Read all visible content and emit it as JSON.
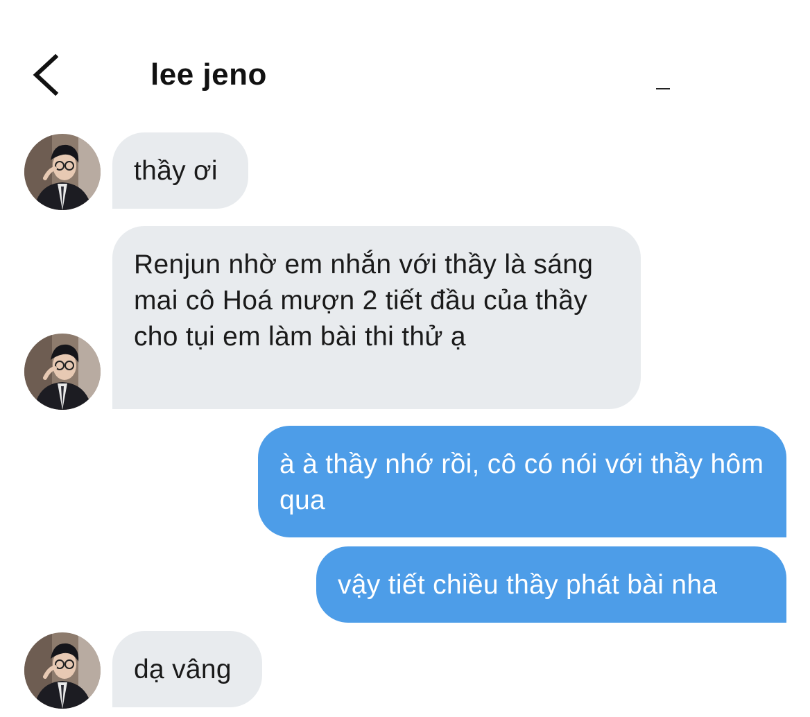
{
  "header": {
    "contact_name": "lee jeno",
    "back_icon": "chevron-left-icon"
  },
  "colors": {
    "incoming_bubble": "#e8ebee",
    "outgoing_bubble": "#4d9de8",
    "outgoing_text": "#ffffff",
    "incoming_text": "#1a1a1a"
  },
  "messages": [
    {
      "direction": "incoming",
      "text": "thầy ơi"
    },
    {
      "direction": "incoming",
      "text": "Renjun nhờ em nhắn với thầy là sáng mai cô Hoá mượn 2 tiết đầu của thầy cho tụi em làm bài thi thử ạ"
    },
    {
      "direction": "outgoing",
      "text": "à à thầy nhớ rồi, cô có nói với thầy hôm qua"
    },
    {
      "direction": "outgoing",
      "text": "vậy tiết chiều thầy phát bài nha"
    },
    {
      "direction": "incoming",
      "text": "dạ vâng"
    }
  ]
}
